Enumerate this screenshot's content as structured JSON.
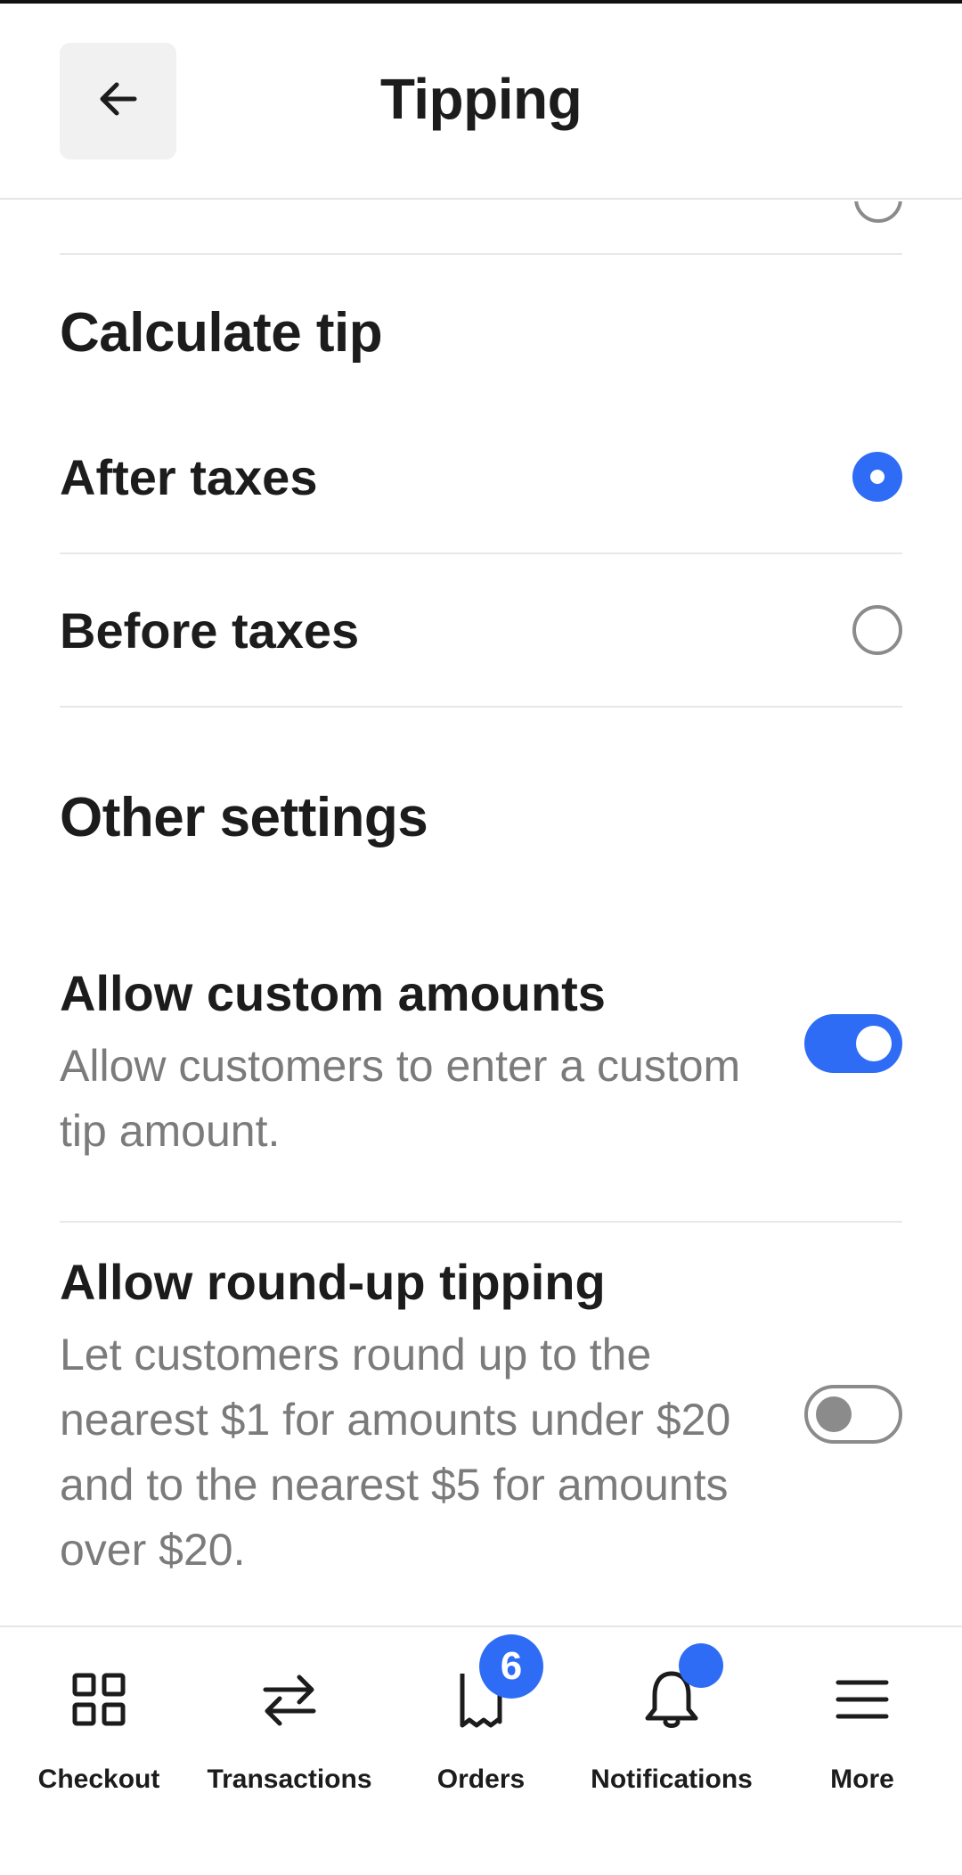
{
  "header": {
    "title": "Tipping",
    "back_icon": "arrow-left-icon"
  },
  "calculate_tip": {
    "heading": "Calculate tip",
    "options": [
      {
        "label": "After taxes",
        "selected": true
      },
      {
        "label": "Before taxes",
        "selected": false
      }
    ]
  },
  "other_settings": {
    "heading": "Other settings",
    "custom_amounts": {
      "title": "Allow custom amounts",
      "description": "Allow customers to enter a custom tip amount.",
      "enabled": true
    },
    "round_up": {
      "title": "Allow round-up tipping",
      "description": "Let customers round up to the nearest $1 for amounts under $20 and to the nearest $5 for amounts over $20.",
      "enabled": false
    }
  },
  "tabbar": {
    "items": [
      {
        "label": "Checkout",
        "icon": "grid-icon"
      },
      {
        "label": "Transactions",
        "icon": "transfer-arrows-icon"
      },
      {
        "label": "Orders",
        "icon": "receipt-icon",
        "badge": "6"
      },
      {
        "label": "Notifications",
        "icon": "bell-icon",
        "dot": true
      },
      {
        "label": "More",
        "icon": "menu-icon"
      }
    ]
  },
  "colors": {
    "accent": "#2f6cf6",
    "text": "#1c1c1c",
    "muted": "#7b7b7b",
    "divider": "#e8e8e8"
  }
}
